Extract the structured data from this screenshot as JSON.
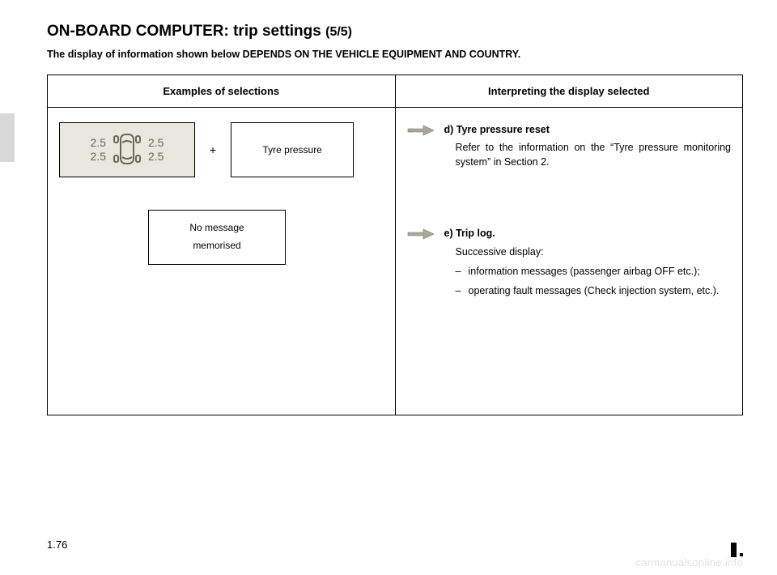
{
  "title_main": "ON-BOARD COMPUTER: trip settings ",
  "title_sub": "(5/5)",
  "notice": "The display of information shown below DEPENDS ON THE VEHICLE EQUIPMENT AND COUNTRY.",
  "table": {
    "header_left": "Examples of selections",
    "header_right": "Interpreting the display selected"
  },
  "left": {
    "tp_fl": "2.5",
    "tp_rl": "2.5",
    "tp_fr": "2.5",
    "tp_rr": "2.5",
    "plus": "+",
    "tyre_label": "Tyre pressure",
    "no_msg_line1": "No message",
    "no_msg_line2": "memorised"
  },
  "right": {
    "d_lead": "d) Tyre pressure reset",
    "d_desc": "Refer to the information on the “Tyre pressure monitoring system” in Section 2.",
    "e_lead": "e) Trip log.",
    "e_sub": "Successive display:",
    "e_li1": "information messages (passenger airbag OFF etc.);",
    "e_li2": "operating fault messages (Check injection system, etc.)."
  },
  "page_number": "1.76",
  "watermark": "carmanualsonline.info"
}
